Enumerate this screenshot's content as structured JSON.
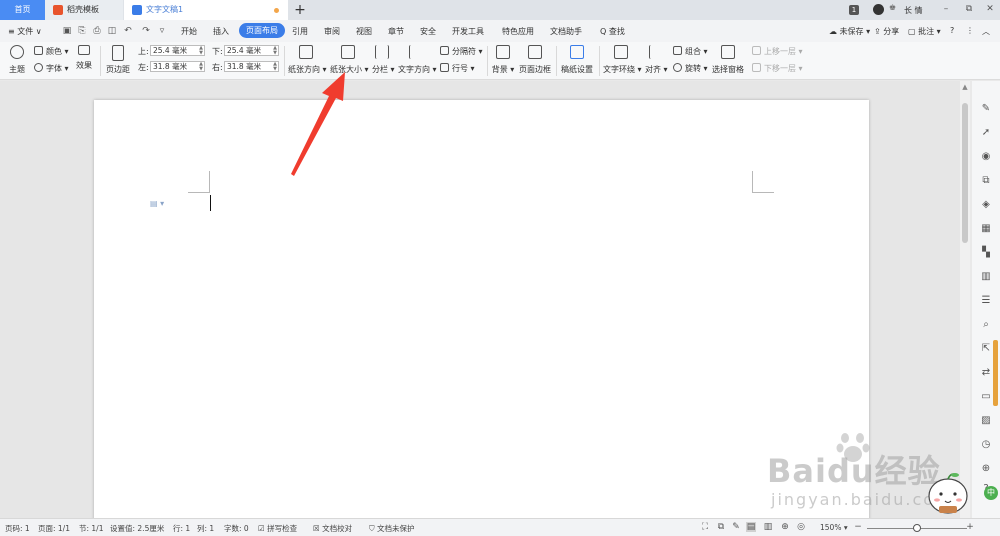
{
  "tabs": {
    "home": "首页",
    "template": "稻壳模板",
    "document": "文字文稿1",
    "add": "+"
  },
  "titlebar_right": {
    "badge": "1",
    "user": "长 情",
    "minimize": "–",
    "restore": "⧉",
    "close": "✕"
  },
  "menu": {
    "file": "≡ 文件 ∨",
    "items": [
      "开始",
      "插入",
      "页面布局",
      "引用",
      "审阅",
      "视图",
      "章节",
      "安全",
      "开发工具",
      "特色应用",
      "文档助手",
      "Q 查找"
    ],
    "active": "页面布局",
    "right": [
      "未保存",
      "分享",
      "批注"
    ]
  },
  "ribbon": {
    "theme": "主题",
    "color": "颜色",
    "font": "字体",
    "effect": "效果",
    "margins": "页边距",
    "margin_labels": {
      "top": "上:",
      "bottom": "下:",
      "left": "左:",
      "right": "右:"
    },
    "margin_values": {
      "top": "25.4 毫米",
      "bottom": "25.4 毫米",
      "left": "31.8 毫米",
      "right": "31.8 毫米"
    },
    "orientation": "纸张方向",
    "paper_size": "纸张大小",
    "columns": "分栏",
    "text_direction": "文字方向",
    "separator": "分隔符",
    "line_number": "行号",
    "background": "背景",
    "page_border": "页面边框",
    "manuscript": "稿纸设置",
    "text_wrap": "文字环绕",
    "align": "对齐",
    "group": "组合",
    "rotate": "旋转",
    "selection_pane": "选择窗格",
    "bring_forward": "上移一层",
    "send_backward": "下移一层"
  },
  "status": {
    "page_num": "页码: 1",
    "pages": "页面: 1/1",
    "section": "节: 1/1",
    "setting": "设置值: 2.5厘米",
    "row": "行: 1",
    "col": "列: 1",
    "words": "字数: 0",
    "spell": "拼写检查",
    "proof": "文档校对",
    "protect": "文档未保护",
    "zoom": "150%"
  },
  "watermark": {
    "main": "Baidu经验",
    "sub": "jingyan.baidu.com"
  },
  "colors": {
    "accent": "#3b7de8",
    "home_tab": "#4a8cf3",
    "arrow": "#f03c2e"
  }
}
